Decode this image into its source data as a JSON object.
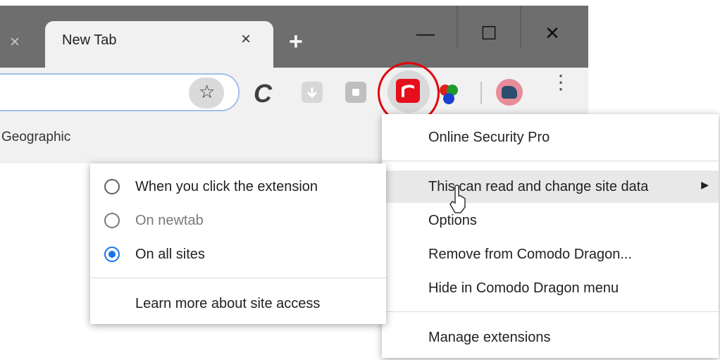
{
  "tabs": {
    "active_title": "New Tab",
    "close_glyph": "×",
    "inactive_close_glyph": "×",
    "new_tab_glyph": "+"
  },
  "window_controls": {
    "minimize_glyph": "—",
    "maximize_glyph": "☐",
    "close_glyph": "✕"
  },
  "toolbar": {
    "star_glyph": "☆",
    "c_glyph": "C",
    "menu_glyph": "⋮",
    "icons": [
      "bookmark-star-icon",
      "comodo-c-icon",
      "download-icon",
      "dice-extension-icon",
      "online-security-pro-icon",
      "colored-balls-icon",
      "profile-avatar-icon",
      "kebab-menu-icon"
    ]
  },
  "bookmarks": {
    "partial_item": "Geographic"
  },
  "extension_menu": {
    "title": "Online Security Pro",
    "items": [
      {
        "label": "This can read and change site data",
        "has_submenu": true,
        "arrow": "▶"
      },
      {
        "label": "Options"
      },
      {
        "label": "Remove from Comodo Dragon..."
      },
      {
        "label": "Hide in Comodo Dragon menu"
      },
      {
        "label": "Manage extensions"
      }
    ]
  },
  "site_access_submenu": {
    "options": [
      {
        "label": "When you click the extension",
        "checked": false,
        "enabled": true
      },
      {
        "label": "On newtab",
        "checked": false,
        "enabled": false
      },
      {
        "label": "On all sites",
        "checked": true,
        "enabled": true
      }
    ],
    "learn_more": "Learn more about site access"
  },
  "colors": {
    "highlight_circle": "#e3000b",
    "extension_icon": "#e60e1c",
    "radio_checked": "#1a73e8"
  }
}
